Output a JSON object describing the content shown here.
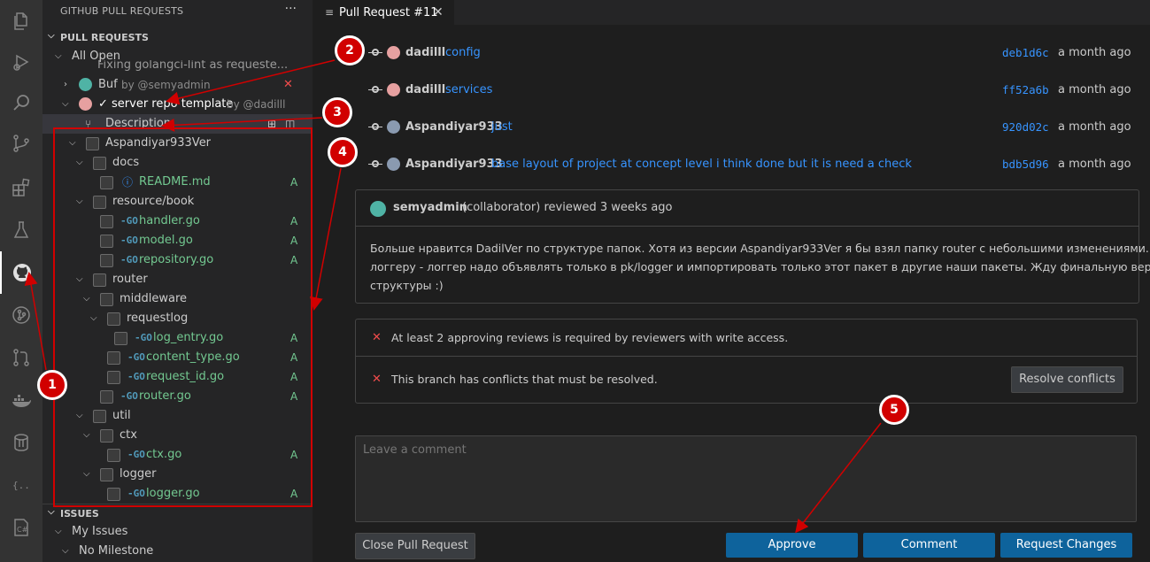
{
  "sidebar": {
    "title": "GITHUB PULL REQUESTS",
    "more": "···",
    "pr_section": "PULL REQUESTS",
    "all_open": "All Open",
    "truncated_item": "Fixing golangci-lint as requeste...",
    "buf_label": "Buf",
    "buf_author": "by @semyadmin",
    "current_pr": "✓ server repo template",
    "current_pr_author": "by @dadilll",
    "description": "Description",
    "issues_section": "ISSUES",
    "my_issues": "My Issues",
    "no_milestone": "No Milestone",
    "file_status_added": "A",
    "tree": {
      "root": "Aspandiyar933Ver",
      "docs": "docs",
      "readme": "README.md",
      "resource_book": "resource/book",
      "handler": "handler.go",
      "model": "model.go",
      "repository": "repository.go",
      "router": "router",
      "middleware": "middleware",
      "requestlog": "requestlog",
      "log_entry": "log_entry.go",
      "content_type": "content_type.go",
      "request_id": "request_id.go",
      "router_go": "router.go",
      "util": "util",
      "ctx": "ctx",
      "ctx_go": "ctx.go",
      "logger": "logger",
      "logger_go": "logger.go"
    }
  },
  "tab": {
    "label": "Pull Request #11"
  },
  "commits": [
    {
      "author": "dadilll",
      "message": "config",
      "hash": "deb1d6c",
      "date": "a month ago"
    },
    {
      "author": "dadilll",
      "message": "services",
      "hash": "ff52a6b",
      "date": "a month ago"
    },
    {
      "author": "Aspandiyar933",
      "message": "just",
      "hash": "920d02c",
      "date": "a month ago"
    },
    {
      "author": "Aspandiyar933",
      "message": "base layout of project at concept level i think done but it is need a check",
      "hash": "bdb5d96",
      "date": "a month ago"
    }
  ],
  "review": {
    "author": "semyadmin",
    "meta": "(collaborator) reviewed 3 weeks ago",
    "body_line1": "Больше нравится DadilVer по структуре папок. Хотя из версии Aspandiyar933Ver я бы взял папку router с небольшими изменениями. ПО",
    "body_line2": "логгеру - логгер надо объявлять только в pk/logger и импортировать только этот пакет в другие наши пакеты. Жду финальную версию",
    "body_line3": "структуры :)"
  },
  "checks": {
    "reviews_required": "At least 2 approving reviews is required by reviewers with write access.",
    "conflicts": "This branch has conflicts that must be resolved.",
    "resolve_button": "Resolve conflicts"
  },
  "comment": {
    "placeholder": "Leave a comment"
  },
  "actions": {
    "close": "Close Pull Request",
    "approve": "Approve",
    "comment": "Comment",
    "request_changes": "Request Changes"
  },
  "annotations": [
    "1",
    "2",
    "3",
    "4",
    "5"
  ],
  "colors": {
    "accent": "#0e639c",
    "link": "#3794ff",
    "added": "#73c991",
    "annotation": "#d10000"
  }
}
